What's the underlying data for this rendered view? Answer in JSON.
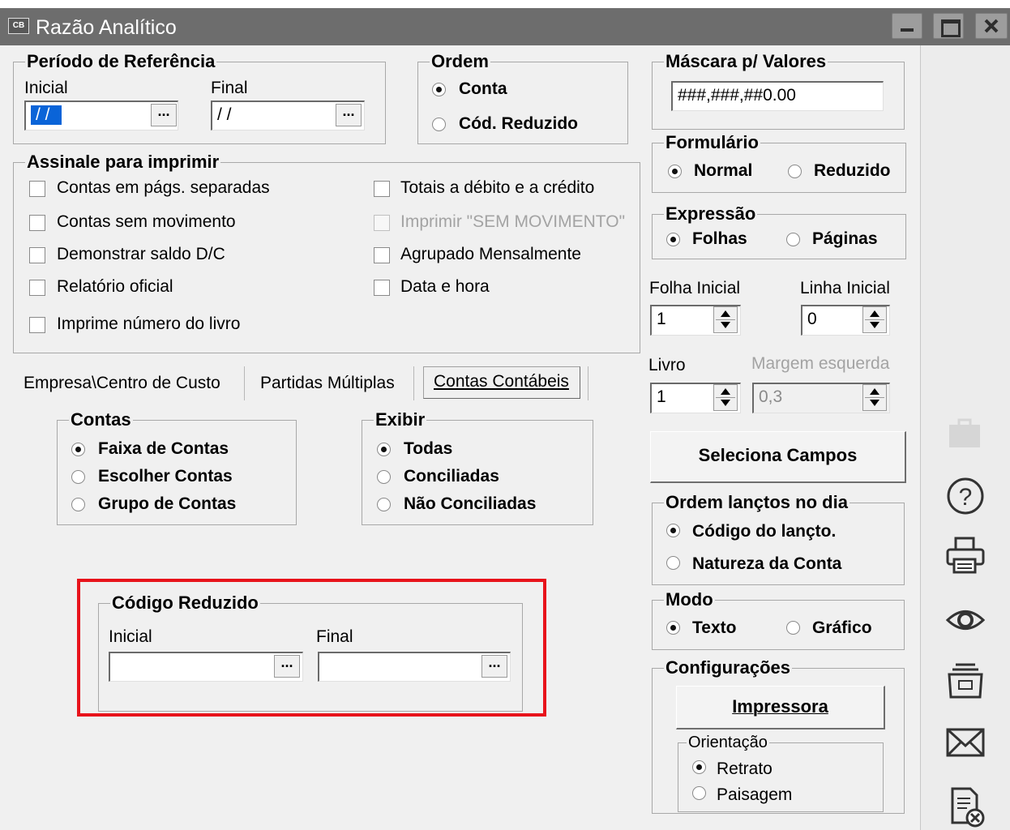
{
  "window": {
    "icon_text": "CB",
    "title": "Razão Analítico"
  },
  "periodo": {
    "caption": "Período de Referência",
    "inicial_label": "Inicial",
    "inicial_value": "/ /",
    "final_label": "Final",
    "final_value": "/ /"
  },
  "ordem": {
    "caption": "Ordem",
    "options": [
      "Conta",
      "Cód. Reduzido"
    ],
    "selected": "Conta"
  },
  "mascara": {
    "caption": "Máscara p/ Valores",
    "value": "###,###,##0.00"
  },
  "formulario": {
    "caption": "Formulário",
    "options": [
      "Normal",
      "Reduzido"
    ],
    "selected": "Normal"
  },
  "expressao": {
    "caption": "Expressão",
    "options": [
      "Folhas",
      "Páginas"
    ],
    "selected": "Folhas"
  },
  "assinale": {
    "caption": "Assinale para imprimir",
    "left": [
      "Contas em págs. separadas",
      "Contas sem movimento",
      "Demonstrar saldo D/C",
      "Relatório oficial",
      "Imprime número do livro"
    ],
    "right": [
      "Totais a débito e a crédito",
      "Imprimir \"SEM MOVIMENTO\"",
      "Agrupado Mensalmente",
      "Data e hora"
    ]
  },
  "folha_inicial": {
    "label": "Folha Inicial",
    "value": "1"
  },
  "linha_inicial": {
    "label": "Linha Inicial",
    "value": "0"
  },
  "livro": {
    "label": "Livro",
    "value": "1"
  },
  "margem": {
    "label": "Margem esquerda",
    "value": "0,3"
  },
  "tabs": [
    "Empresa\\Centro de Custo",
    "Partidas Múltiplas",
    "Contas Contábeis"
  ],
  "active_tab": "Contas Contábeis",
  "contas": {
    "caption": "Contas",
    "options": [
      "Faixa de Contas",
      "Escolher Contas",
      "Grupo de Contas"
    ],
    "selected": "Faixa de Contas"
  },
  "exibir": {
    "caption": "Exibir",
    "options": [
      "Todas",
      "Conciliadas",
      "Não Conciliadas"
    ],
    "selected": "Todas"
  },
  "codigo_reduzido": {
    "caption": "Código Reduzido",
    "inicial_label": "Inicial",
    "final_label": "Final",
    "inicial_value": "",
    "final_value": ""
  },
  "seleciona_campos": "Seleciona Campos",
  "ordem_lanctos": {
    "caption": "Ordem lançtos no dia",
    "options": [
      "Código do lançto.",
      "Natureza da Conta"
    ],
    "selected": "Código do lançto."
  },
  "modo": {
    "caption": "Modo",
    "options": [
      "Texto",
      "Gráfico"
    ],
    "selected": "Texto"
  },
  "configuracoes": {
    "caption": "Configurações",
    "impressora": "Impressora",
    "orientacao_caption": "Orientação",
    "options": [
      "Retrato",
      "Paisagem"
    ],
    "selected": "Retrato"
  },
  "ellipsis": "...",
  "sidebar_icons": [
    "briefcase-icon",
    "help-icon",
    "printer-icon",
    "preview-eye-icon",
    "export-icon",
    "email-icon",
    "close-document-icon"
  ],
  "colors": {
    "titlebar": "#6d6d6d",
    "highlight_border": "#e8131b",
    "selection": "#0a64d8"
  }
}
